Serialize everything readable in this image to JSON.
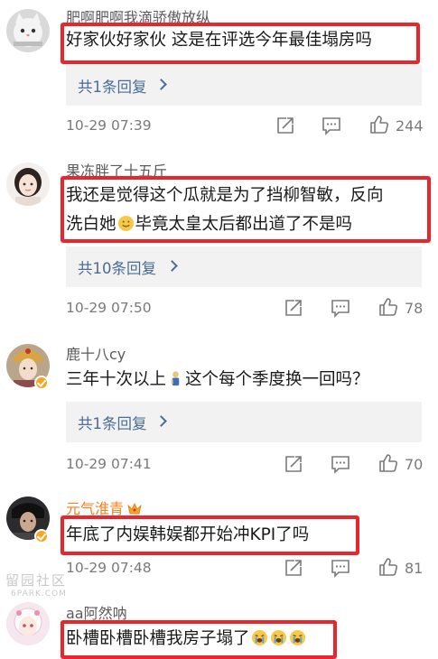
{
  "comments": [
    {
      "username": "肥啊肥啊我滴骄傲放纵",
      "lines": [
        "好家伙好家伙 这是在评选今年最佳塌房吗"
      ],
      "replies": "共1条回复",
      "time": "10-29 07:39",
      "likes": "244",
      "avatar_icon": "cat-avatar"
    },
    {
      "username": "果冻胖了十五斤",
      "lines": [
        "我还是觉得这个瓜就是为了挡柳智敏，反向",
        "洗白她",
        "毕竟太皇太后都出道了不是吗"
      ],
      "replies": "共10条回复",
      "time": "10-29 07:50",
      "likes": "78",
      "avatar_icon": "girl-avatar"
    },
    {
      "username": "鹿十八cy",
      "lines": [
        "三年十次以上",
        "这个每个季度换一回吗？"
      ],
      "replies": "共1条回复",
      "time": "10-29 07:41",
      "likes": "70",
      "avatar_icon": "costume-avatar"
    },
    {
      "username": "元气淮青",
      "lines": [
        "年底了内娱韩娱都开始冲KPI了吗"
      ],
      "time": "10-29 07:48",
      "likes": "81",
      "avatar_icon": "dark-avatar"
    },
    {
      "username": "aa阿然呐",
      "lines": [
        "卧槽卧槽卧槽我房子塌了"
      ],
      "avatar_icon": "anime-avatar"
    }
  ],
  "watermark": {
    "top": "留园社区",
    "bottom": "6PARK.COM"
  },
  "colors": {
    "highlight": "#e8262b",
    "link": "#4a6c96",
    "vip_name": "#f5801f",
    "meta": "#7a7a7a"
  }
}
